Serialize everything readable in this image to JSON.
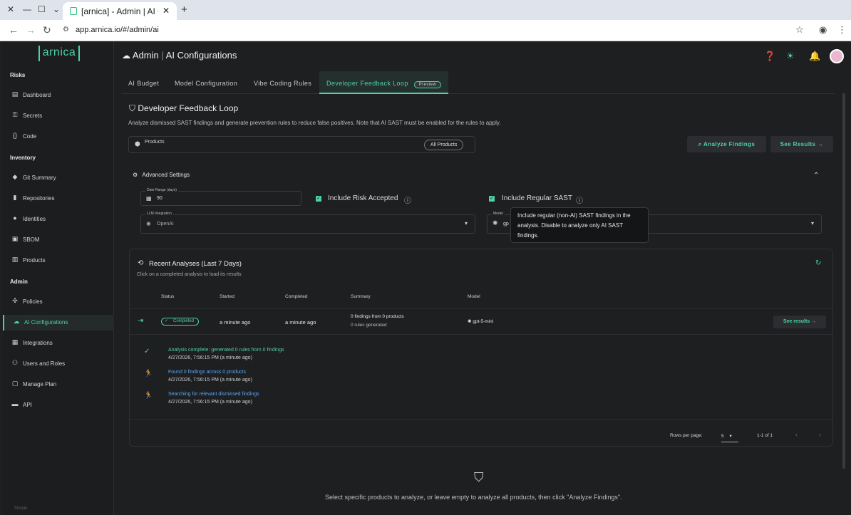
{
  "browser": {
    "tab_title": "[arnica] - Admin | AI C",
    "url": "app.arnica.io/#/admin/ai"
  },
  "sidebar": {
    "logo": "arnica",
    "sections": [
      {
        "title": "Risks",
        "items": [
          "Dashboard",
          "Secrets",
          "Code"
        ]
      },
      {
        "title": "Inventory",
        "items": [
          "Git Summary",
          "Repositories",
          "Identities",
          "SBOM",
          "Products"
        ]
      },
      {
        "title": "Admin",
        "items": [
          "Policies",
          "AI Configurations",
          "Integrations",
          "Users and Roles",
          "Manage Plan",
          "API"
        ]
      }
    ],
    "footer": "Simple"
  },
  "header": {
    "section": "Admin",
    "title": "AI Configurations"
  },
  "tabs": [
    {
      "label": "AI Budget"
    },
    {
      "label": "Model Configuration"
    },
    {
      "label": "Vibe Coding Rules"
    },
    {
      "label": "Developer Feedback Loop",
      "badge": "Preview"
    }
  ],
  "page": {
    "title": "Developer Feedback Loop",
    "description": "Analyze dismissed SAST findings and generate prevention rules to reduce false positives. Note that AI SAST must be enabled for the rules to apply.",
    "products_label": "Products",
    "products_chip": "All Products",
    "analyze_button": "Analyze Findings",
    "see_results_button": "See Results",
    "advanced_settings": "Advanced Settings",
    "date_range_label": "Date Range (days)",
    "date_range_value": "90",
    "include_risk_accepted": "Include Risk Accepted",
    "include_regular_sast": "Include Regular SAST",
    "llm_label": "LLM Integration",
    "llm_value": "OpenAI",
    "model_label": "Model",
    "model_value": "gp",
    "tooltip": "Include regular (non-AI) SAST findings in the analysis. Disable to analyze only AI SAST findings."
  },
  "recent": {
    "title": "Recent Analyses (Last 7 Days)",
    "subtitle": "Click on a completed analysis to load its results",
    "columns": [
      "Status",
      "Started",
      "Completed",
      "Summary",
      "Model"
    ],
    "row": {
      "status": "Completed",
      "started": "a minute ago",
      "completed": "a minute ago",
      "summary1": "0 findings from 0 products",
      "summary2": "0 rules generated",
      "model": "gpt-5-mini",
      "action": "See results"
    },
    "log": [
      {
        "msg": "Analysis complete: generated 0 rules from 0 findings",
        "ts": "4/27/2026, 7:56:15 PM (a minute ago)",
        "color": "#4fd1a5"
      },
      {
        "msg": "Found 0 findings across 0 products",
        "ts": "4/27/2026, 7:56:15 PM (a minute ago)",
        "color": "#5aa7f0"
      },
      {
        "msg": "Searching for relevant dismissed findings",
        "ts": "4/27/2026, 7:56:15 PM (a minute ago)",
        "color": "#5aa7f0"
      }
    ],
    "rows_per_page_label": "Rows per page:",
    "rows_per_page": "5",
    "range": "1-1 of 1"
  },
  "bottom_note": "Select specific products to analyze, or leave empty to analyze all products, then click \"Analyze Findings\"."
}
